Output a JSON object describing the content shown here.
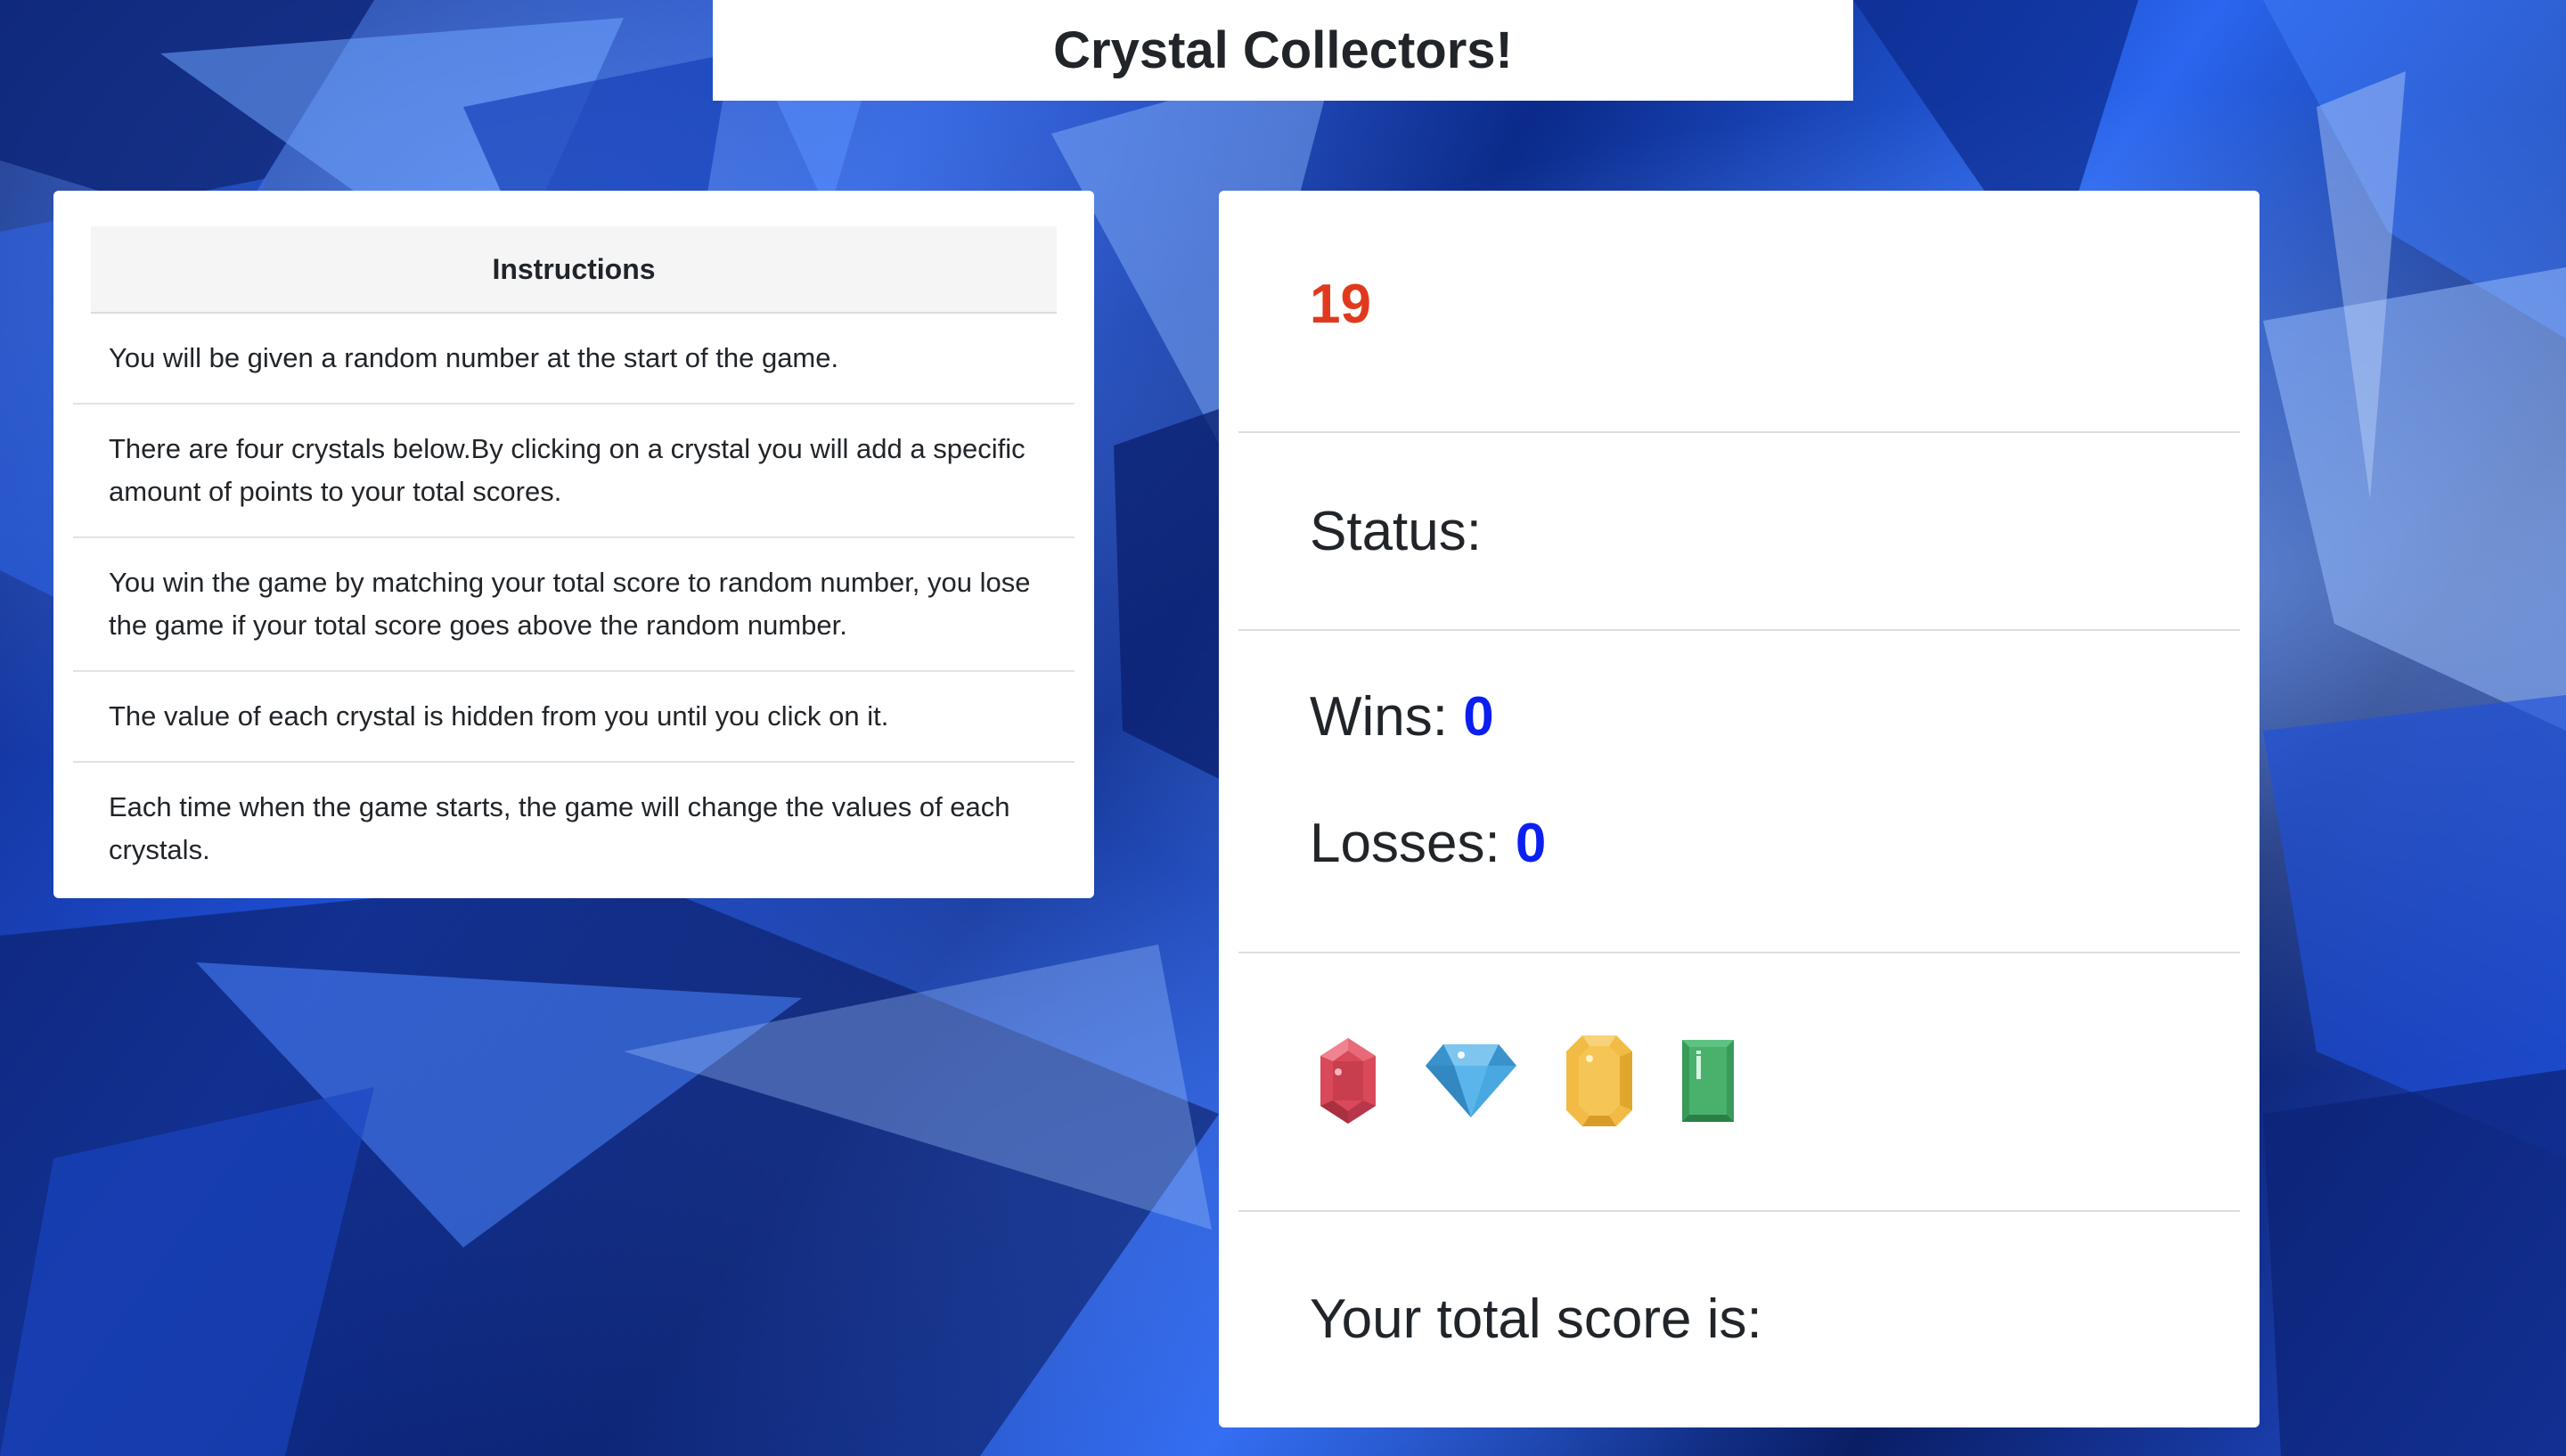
{
  "header": {
    "title": "Crystal Collectors!"
  },
  "instructions": {
    "heading": "Instructions",
    "items": [
      "You will be given a random number at the start of the game.",
      "There are four crystals below.By clicking on a crystal you will add a specific amount of points to your total scores.",
      "You win the game by matching your total score to random number, you lose the game if your total score goes above the random number.",
      "The value of each crystal is hidden from you until you click on it.",
      "Each time when the game starts, the game will change the values of each crystals."
    ]
  },
  "game": {
    "target_number": "19",
    "status_label": "Status:",
    "wins_label": "Wins:",
    "wins_value": "0",
    "losses_label": "Losses:",
    "losses_value": "0",
    "crystals": [
      {
        "icon": "red-ruby-crystal-icon",
        "color": "#d9495a"
      },
      {
        "icon": "blue-diamond-crystal-icon",
        "color": "#4aa8e0"
      },
      {
        "icon": "yellow-topaz-crystal-icon",
        "color": "#f2bb45"
      },
      {
        "icon": "green-emerald-crystal-icon",
        "color": "#3a9a5a"
      }
    ],
    "total_score_label": "Your total score is:"
  },
  "colors": {
    "target_number": "#e03a1e",
    "counter_value": "#0b1ff0",
    "background_blue": "#1f4fd6"
  }
}
